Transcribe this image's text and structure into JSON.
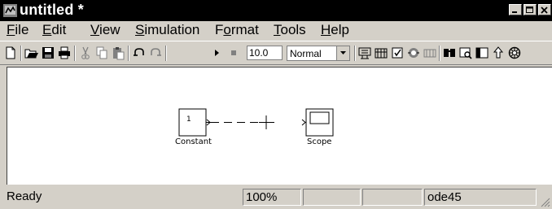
{
  "window": {
    "title": "untitled *"
  },
  "menu": [
    {
      "label": "File",
      "key": "F",
      "rest": "ile"
    },
    {
      "label": "Edit",
      "key": "E",
      "rest": "dit"
    },
    {
      "label": "View",
      "key": "V",
      "rest": "iew"
    },
    {
      "label": "Simulation",
      "key": "S",
      "rest": "imulation"
    },
    {
      "label": "Format",
      "key": "o",
      "pre": "F",
      "rest": "rmat"
    },
    {
      "label": "Tools",
      "key": "T",
      "rest": "ools"
    },
    {
      "label": "Help",
      "key": "H",
      "rest": "elp"
    }
  ],
  "toolbar": {
    "stop_time": "10.0",
    "sim_mode": "Normal"
  },
  "canvas": {
    "blocks": {
      "constant": {
        "label": "Constant",
        "value": "1"
      },
      "scope": {
        "label": "Scope"
      }
    }
  },
  "status": {
    "state": "Ready",
    "zoom": "100%",
    "solver": "ode45"
  }
}
